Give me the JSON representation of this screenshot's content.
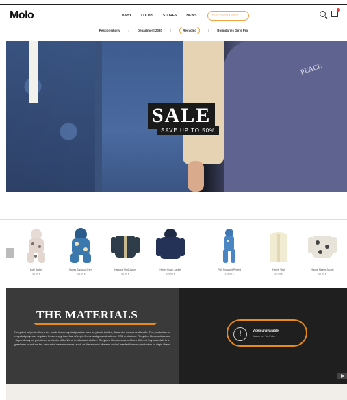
{
  "header": {
    "logo": "Molo",
    "nav": [
      "BABY",
      "LOOKS",
      "STORES",
      "NEWS"
    ],
    "nav_highlight": "DISCOVER MOLO"
  },
  "subnav": {
    "items": [
      "Responsibility",
      "Department 2030",
      "Recycled",
      "Boundaries Girls Pro"
    ]
  },
  "hero": {
    "sale_text": "SALE",
    "sale_sub": "SAVE UP TO 50%",
    "sweater_text": "PEACE"
  },
  "products": [
    {
      "name": "Bobi Jacket",
      "price": "49,99 €"
    },
    {
      "name": "Hayes Snowsuit Fern",
      "price": "149,99 €"
    },
    {
      "name": "Harlowe Shirt Jacket",
      "price": "59,99 €"
    },
    {
      "name": "Hailee Down Jacket",
      "price": "149,99 €"
    },
    {
      "name": "Polli Snowsuit Printed",
      "price": "179,99 €"
    },
    {
      "name": "Heddy Vest",
      "price": "39,99 €"
    },
    {
      "name": "Hanne Fleece Jacket",
      "price": "59,99 €"
    }
  ],
  "materials": {
    "title": "THE MATERIALS",
    "body": "Recycled polyester fibers are made from recycled plastics such as plastic bottles, discarded fabrics and textile. The production of recycled polyester requires less energy than that of virgin fibers and generates fewer CO2 emissions. Recycled fibers reduce our dependency on petroleum and extend the life of textiles and clothes. Recycled fibers recovered from different key materials is a great way to reduce the amount of new resources, such as the amount of water and oil needed for new production of virgin fibers.",
    "video_title": "Video unavailable",
    "video_sub": "Watch on YouTube"
  }
}
